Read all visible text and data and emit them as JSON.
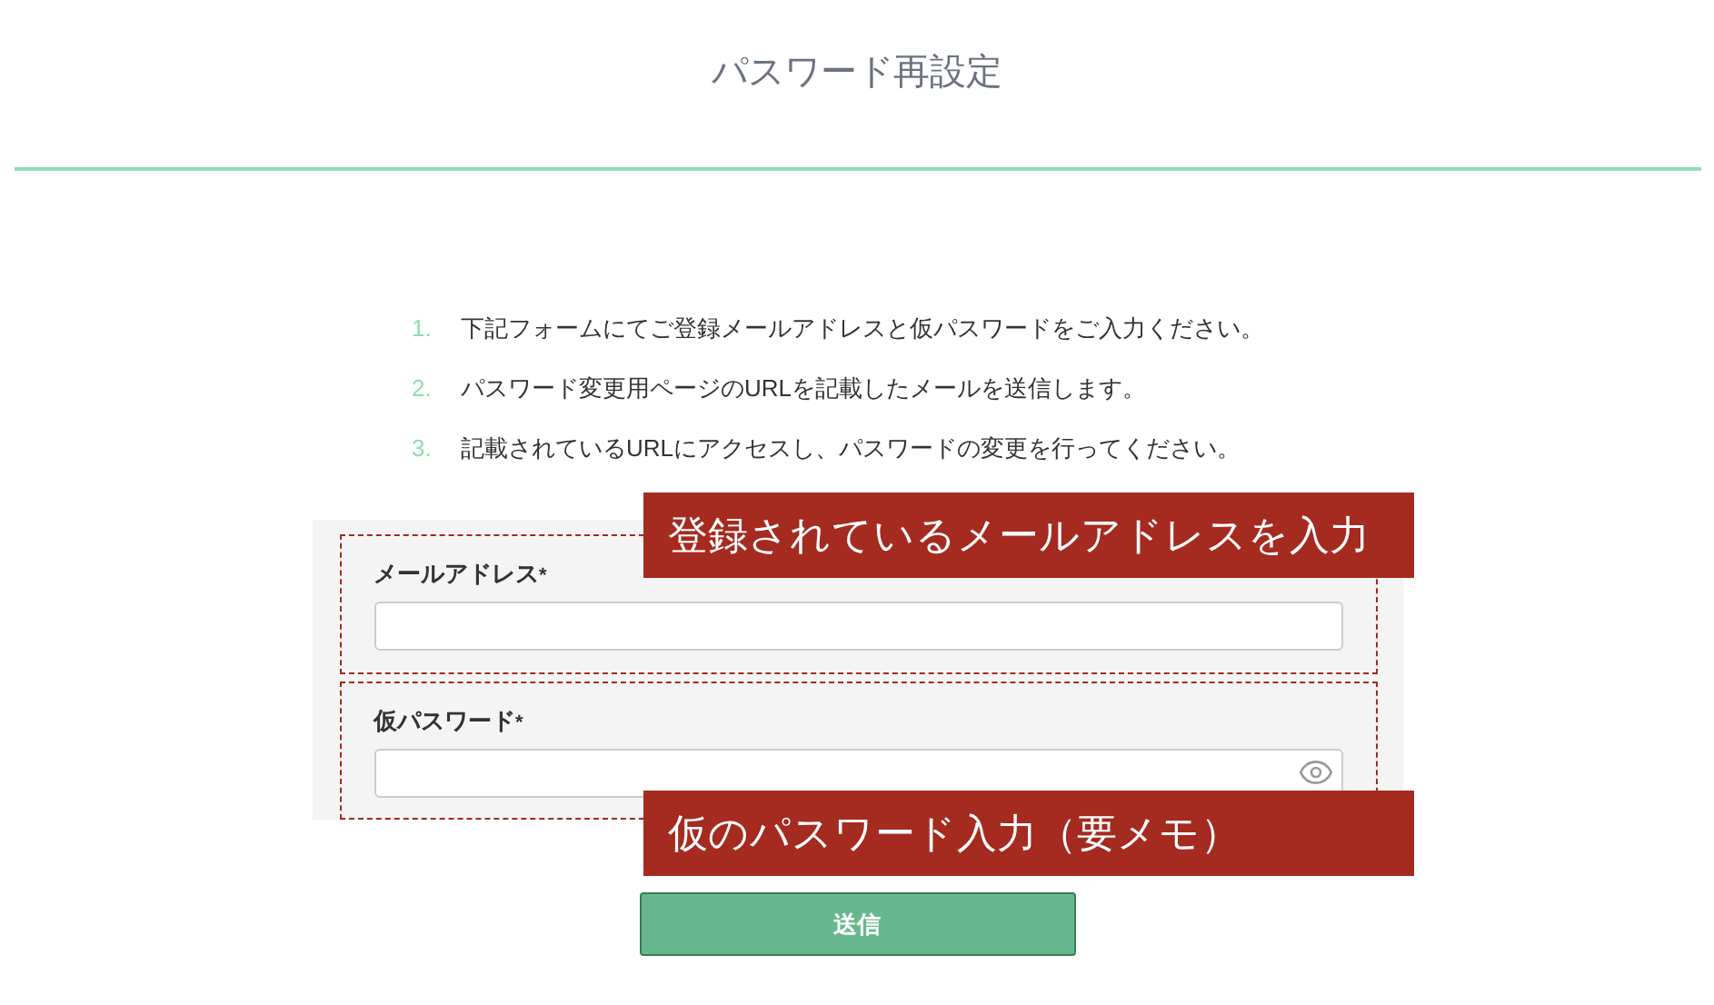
{
  "title": "パスワード再設定",
  "steps": [
    {
      "number": "1.",
      "text": "下記フォームにてご登録メールアドレスと仮パスワードをご入力ください。"
    },
    {
      "number": "2.",
      "text": "パスワード変更用ページのURLを記載したメールを送信します。"
    },
    {
      "number": "3.",
      "text": "記載されているURLにアクセスし、パスワードの変更を行ってください。"
    }
  ],
  "fields": [
    {
      "kind": "email",
      "label": "メールアドレス",
      "required_mark": "*",
      "annotation": "登録されているメールアドレスを入力"
    },
    {
      "kind": "password",
      "label": "仮パスワード",
      "required_mark": "*",
      "annotation": "仮のパスワード入力（要メモ）"
    }
  ],
  "submit_button": "送信"
}
